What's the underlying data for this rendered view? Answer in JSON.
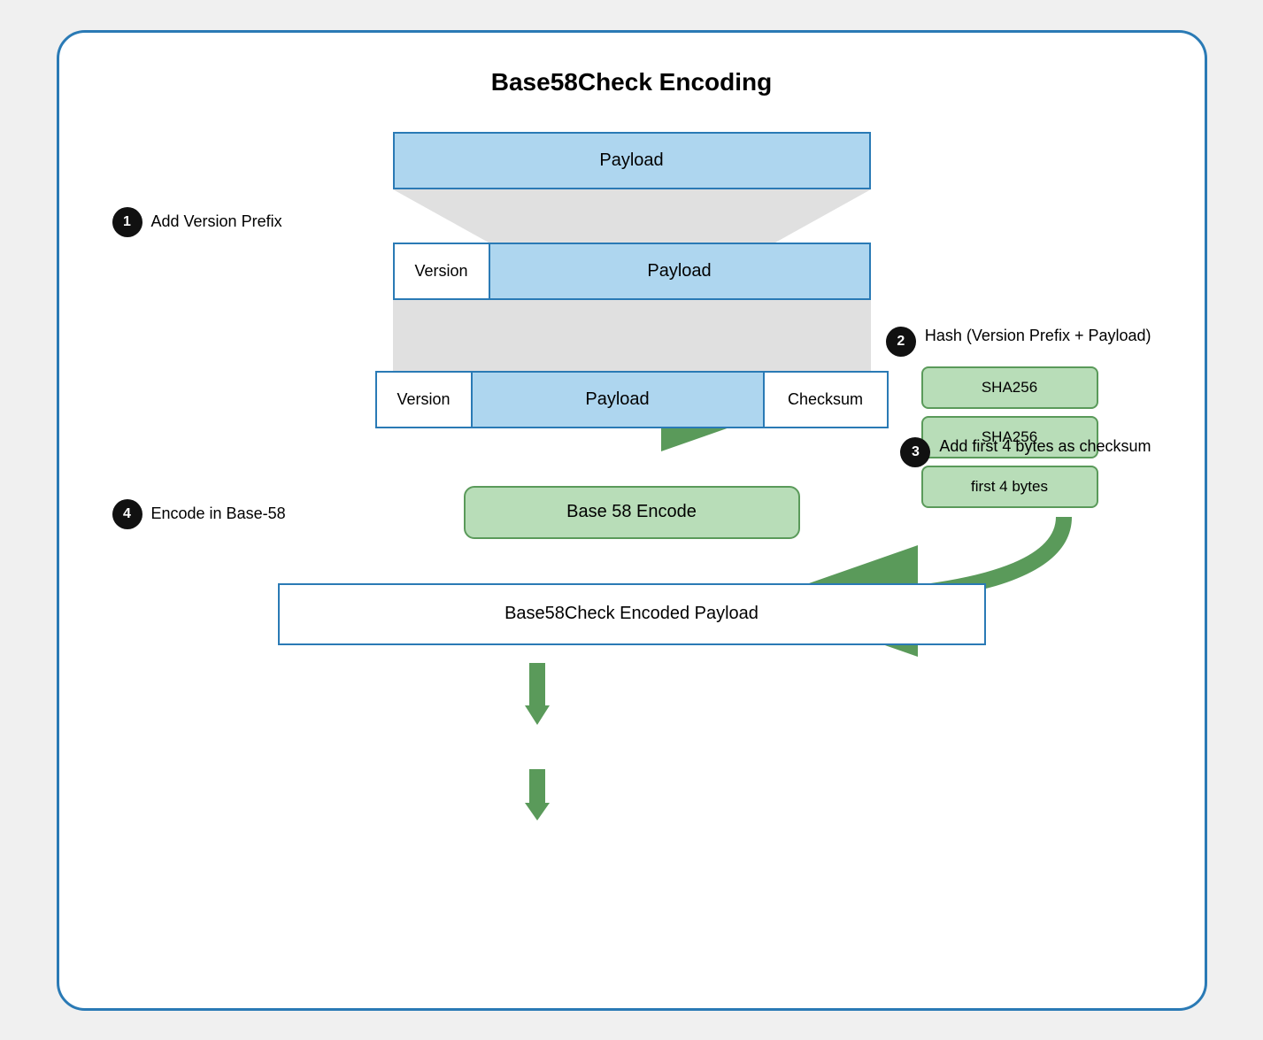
{
  "title": "Base58Check Encoding",
  "steps": [
    {
      "number": "1",
      "label": "Add Version Prefix"
    },
    {
      "number": "2",
      "label": "Hash (Version Prefix + Payload)"
    },
    {
      "number": "3",
      "label": "Add first 4 bytes as checksum"
    },
    {
      "number": "4",
      "label": "Encode in Base-58"
    }
  ],
  "boxes": {
    "payload_top": "Payload",
    "version1": "Version",
    "payload_mid": "Payload",
    "sha256_1": "SHA256",
    "sha256_2": "SHA256",
    "first4bytes": "first 4 bytes",
    "version2": "Version",
    "payload2": "Payload",
    "checksum": "Checksum",
    "base58encode": "Base 58 Encode",
    "final_output": "Base58Check Encoded Payload"
  },
  "colors": {
    "blue_border": "#2a7ab5",
    "blue_fill": "#aed6ef",
    "green_fill": "#b8ddb8",
    "green_border": "#5a9a5a",
    "gray_fill": "#e0e0e0"
  }
}
